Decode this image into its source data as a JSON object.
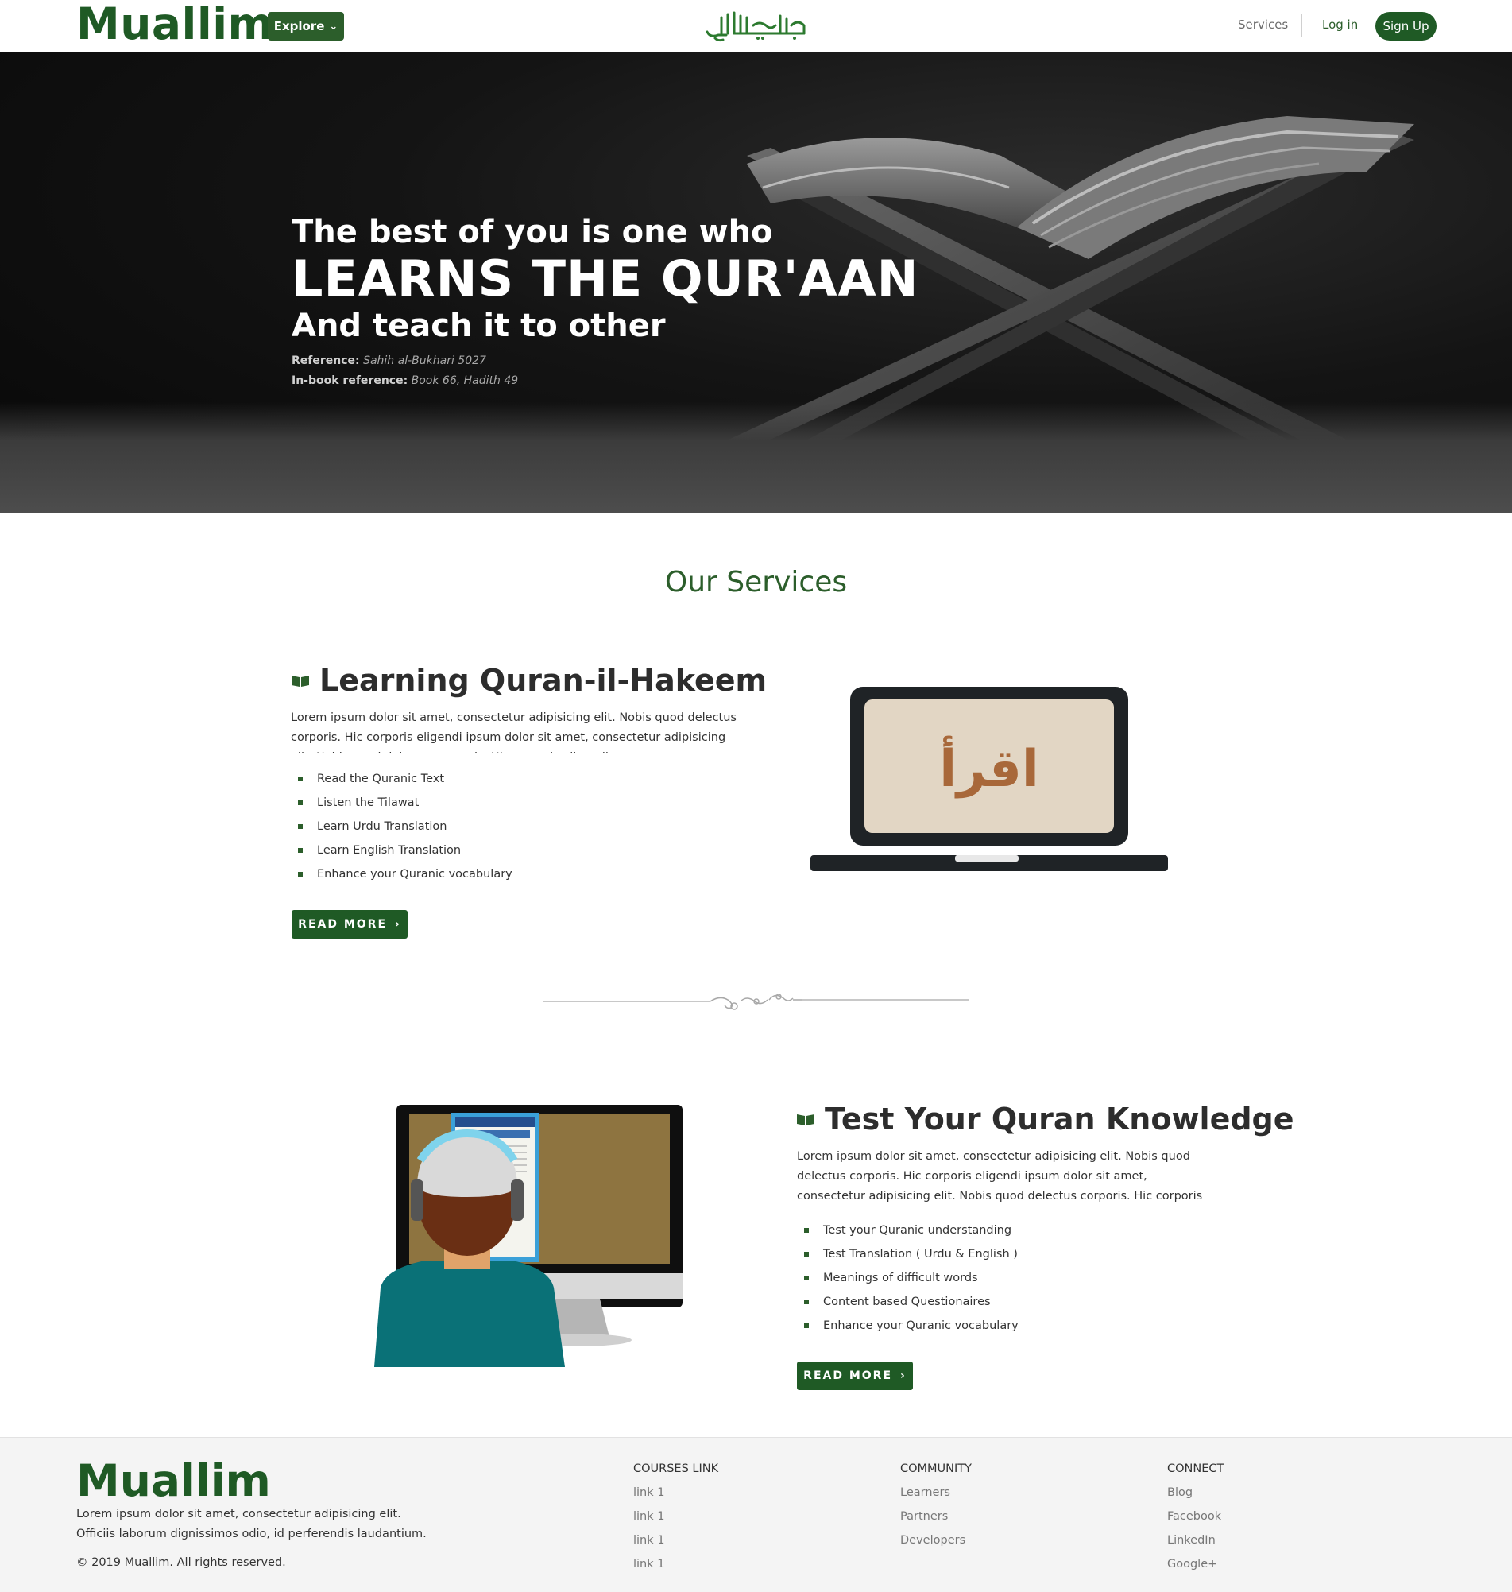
{
  "brand": "Muallim",
  "nav": {
    "explore_label": "Explore",
    "services_label": "Services",
    "login_label": "Log in",
    "signup_label": "Sign Up"
  },
  "hero": {
    "line1": "The best of you is one who",
    "line2": "LEARNS THE QUR'AAN",
    "line3": "And teach it to other",
    "ref_label": "Reference:",
    "ref_value": "Sahih al-Bukhari 5027",
    "inbook_label": "In-book reference:",
    "inbook_value": "Book 66, Hadith 49"
  },
  "services": {
    "title": "Our Services",
    "items": [
      {
        "heading": "Learning Quran-il-Hakeem",
        "description": "Lorem ipsum dolor sit amet, consectetur adipisicing elit. Nobis quod delectus corporis. Hic corporis eligendi ipsum dolor sit amet, consectetur adipisicing elit. Nobis quod delectus corporis. Hic corporis eligendi.",
        "bullets": [
          "Read the Quranic Text",
          "Listen the Tilawat",
          "Learn Urdu Translation",
          "Learn English Translation",
          "Enhance your Quranic vocabulary"
        ],
        "button": "READ MORE",
        "image_text": "اقرأ"
      },
      {
        "heading": "Test Your Quran Knowledge",
        "description": "Lorem ipsum dolor sit amet, consectetur adipisicing elit. Nobis quod delectus corporis. Hic corporis eligendi ipsum dolor sit amet, consectetur adipisicing elit. Nobis quod delectus corporis. Hic corporis eligendi.",
        "bullets": [
          "Test your Quranic understanding",
          "Test Translation ( Urdu & English )",
          "Meanings of difficult words",
          "Content based Questionaires",
          "Enhance your Quranic vocabulary"
        ],
        "button": "READ MORE"
      }
    ]
  },
  "footer": {
    "brand": "Muallim",
    "desc_line1": "Lorem ipsum dolor sit amet, consectetur adipisicing elit.",
    "desc_line2": "Officiis laborum dignissimos odio, id perferendis laudantium.",
    "copyright": "© 2019 Muallim. All rights reserved.",
    "columns": [
      {
        "title": "COURSES LINK",
        "links": [
          "link 1",
          "link 1",
          "link 1",
          "link 1"
        ]
      },
      {
        "title": "COMMUNITY",
        "links": [
          "Learners",
          "Partners",
          "Developers"
        ]
      },
      {
        "title": "CONNECT",
        "links": [
          "Blog",
          "Facebook",
          "LinkedIn",
          "Google+"
        ]
      }
    ]
  },
  "icons": {
    "explore_chevron": "chevron-down-icon",
    "read_more_chevron": "chevron-right-icon",
    "service_icon": "book-icon"
  },
  "colors": {
    "brand_green": "#1f5a25",
    "accent_green": "#2c5e2b",
    "footer_bg": "#f4f4f4",
    "hero_bg": "#0b0b0b"
  }
}
